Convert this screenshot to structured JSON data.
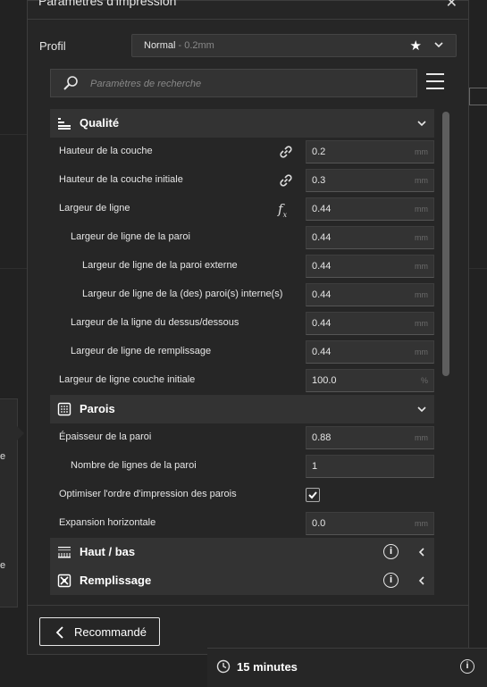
{
  "window": {
    "title": "Paramètres d'impression",
    "close_label": "✕"
  },
  "profile": {
    "label": "Profil",
    "name": "Normal",
    "sub": " - 0.2mm"
  },
  "search": {
    "placeholder": "Paramètres de recherche",
    "value": ""
  },
  "categories": [
    {
      "label": "Qualité",
      "icon": "quality-icon",
      "expanded": true
    },
    {
      "label": "Parois",
      "icon": "walls-icon",
      "expanded": true
    },
    {
      "label": "Haut / bas",
      "icon": "top-bottom-icon",
      "expanded": false
    },
    {
      "label": "Remplissage",
      "icon": "infill-icon",
      "expanded": false
    }
  ],
  "quality_rows": [
    {
      "label": "Hauteur de la couche",
      "value": "0.2",
      "unit": "mm",
      "icon": "link-icon"
    },
    {
      "label": "Hauteur de la couche initiale",
      "value": "0.3",
      "unit": "mm",
      "icon": "link-icon"
    },
    {
      "label": "Largeur de ligne",
      "value": "0.44",
      "unit": "mm",
      "icon": "function-icon"
    },
    {
      "label": "Largeur de ligne de la paroi",
      "value": "0.44",
      "unit": "mm"
    },
    {
      "label": "Largeur de ligne de la paroi externe",
      "value": "0.44",
      "unit": "mm"
    },
    {
      "label": "Largeur de ligne de la (des) paroi(s) interne(s)",
      "value": "0.44",
      "unit": "mm"
    },
    {
      "label": "Largeur de la ligne du dessus/dessous",
      "value": "0.44",
      "unit": "mm"
    },
    {
      "label": "Largeur de ligne de remplissage",
      "value": "0.44",
      "unit": "mm"
    },
    {
      "label": "Largeur de ligne couche initiale",
      "value": "100.0",
      "unit": "%"
    }
  ],
  "walls_rows": [
    {
      "label": "Épaisseur de la paroi",
      "value": "0.88",
      "unit": "mm"
    },
    {
      "label": "Nombre de lignes de la paroi",
      "value": "1",
      "unit": ""
    },
    {
      "label": "Optimiser l'ordre d'impression des parois",
      "checked": true
    },
    {
      "label": "Expansion horizontale",
      "value": "0.0",
      "unit": "mm"
    }
  ],
  "footer": {
    "recommended_label": "Recommandé"
  },
  "estimate": {
    "time": "15 minutes"
  },
  "left_popup": {
    "text1": "e",
    "text2": "e"
  },
  "colors": {
    "panel": "#262626",
    "category": "#333333",
    "field": "#333333"
  }
}
